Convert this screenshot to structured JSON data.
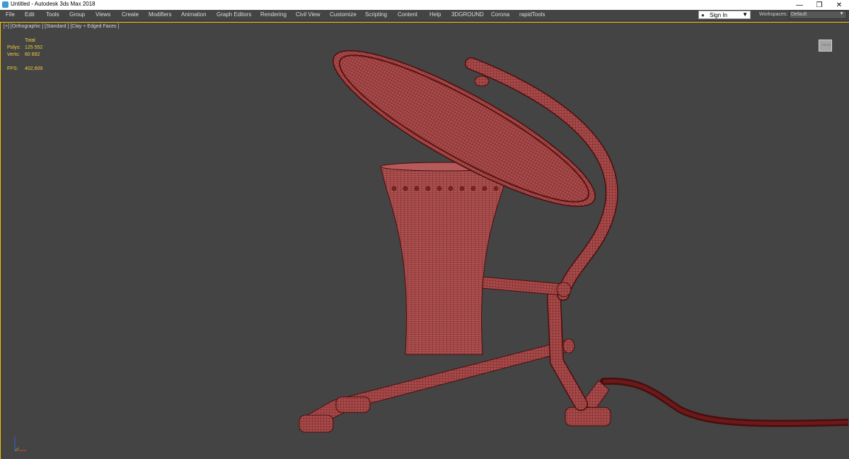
{
  "window": {
    "title": "Untitled - Autodesk 3ds Max 2018",
    "minimize_glyph": "—",
    "restore_glyph": "❐",
    "close_glyph": "✕"
  },
  "menu": {
    "items": [
      "File",
      "Edit",
      "Tools",
      "Group",
      "Views",
      "Create",
      "Modifiers",
      "Animation",
      "Graph Editors",
      "Rendering",
      "Civil View",
      "Customize",
      "Scripting",
      "Content",
      "Help",
      "3DGROUND",
      "Corona",
      "rapidTools"
    ]
  },
  "signin": {
    "label": "Sign In",
    "icon": "user-icon"
  },
  "workspaces": {
    "label": "Workspaces:",
    "value": "Default"
  },
  "viewport": {
    "label": "[+] [Orthographic ] [Standard ] [Clay + Edged Faces ]",
    "stats": {
      "header": "Total",
      "polys_label": "Polys:",
      "polys_value": "125 552",
      "verts_label": "Verts:",
      "verts_value": "60 892",
      "fps_label": "FPS:",
      "fps_value": "402,609"
    },
    "viewcube_label": "FRONT"
  },
  "colors": {
    "model_fill": "#a84a4a",
    "wire": "#4a0d0d",
    "viewport_bg": "#444444",
    "active_border": "#f2c400",
    "stats_text": "#f0cc3a"
  }
}
